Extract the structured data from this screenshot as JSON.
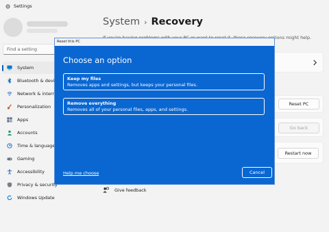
{
  "app": {
    "title": "Settings"
  },
  "search": {
    "placeholder": "Find a setting"
  },
  "sidebar": {
    "items": [
      {
        "label": "System",
        "icon": "monitor-icon",
        "color": "#0078d4"
      },
      {
        "label": "Bluetooth & devices",
        "icon": "bluetooth-icon",
        "color": "#0067c0"
      },
      {
        "label": "Network & internet",
        "icon": "wifi-icon",
        "color": "#2b6fb8"
      },
      {
        "label": "Personalization",
        "icon": "brush-icon",
        "color": "#c0622b"
      },
      {
        "label": "Apps",
        "icon": "apps-icon",
        "color": "#5a6e87"
      },
      {
        "label": "Accounts",
        "icon": "person-icon",
        "color": "#1f9d6b"
      },
      {
        "label": "Time & language",
        "icon": "globe-clock-icon",
        "color": "#1a73c8"
      },
      {
        "label": "Gaming",
        "icon": "gamepad-icon",
        "color": "#6b7580"
      },
      {
        "label": "Accessibility",
        "icon": "accessibility-icon",
        "color": "#1f5fbf"
      },
      {
        "label": "Privacy & security",
        "icon": "shield-icon",
        "color": "#7a7f86"
      },
      {
        "label": "Windows Update",
        "icon": "update-icon",
        "color": "#0078d4"
      }
    ]
  },
  "header": {
    "crumb": "System",
    "separator": "›",
    "current": "Recovery"
  },
  "intro_text": "If you're having problems with your PC or want to reset it, these recovery options might help.",
  "buttons": {
    "reset_pc": "Reset PC",
    "go_back": "Go back",
    "restart_now": "Restart now"
  },
  "feedback": {
    "label": "Give feedback"
  },
  "dialog": {
    "title": "Reset this PC",
    "heading": "Choose an option",
    "options": [
      {
        "title": "Keep my files",
        "description": "Removes apps and settings, but keeps your personal files."
      },
      {
        "title": "Remove everything",
        "description": "Removes all of your personal files, apps, and settings."
      }
    ],
    "help_link": "Help me choose",
    "cancel": "Cancel"
  },
  "colors": {
    "accent": "#0a67d2",
    "dialog_bg": "#0a67d2",
    "page_bg": "#f3f3f3"
  }
}
